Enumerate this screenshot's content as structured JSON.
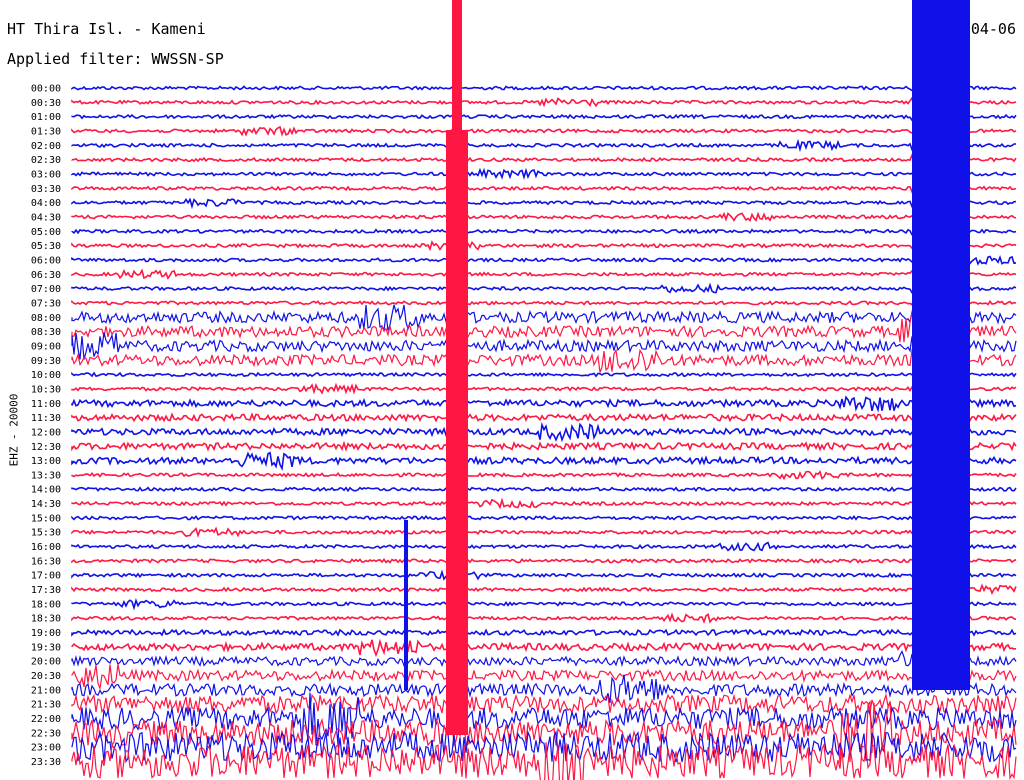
{
  "header": {
    "station": "HT Thira Isl. - Kameni",
    "filter_label": "Applied filter: WWSSN-SP",
    "date_fragment": "-04-06"
  },
  "axis": {
    "channel_label": "EHZ - 20000"
  },
  "colors": {
    "trace_a": "#1010e8",
    "trace_b": "#ff1744",
    "background": "#ffffff"
  },
  "chart_data": {
    "type": "seismogram",
    "row_labels": [
      "00:00",
      "00:30",
      "01:00",
      "01:30",
      "02:00",
      "02:30",
      "03:00",
      "03:30",
      "04:00",
      "04:30",
      "05:00",
      "05:30",
      "06:00",
      "06:30",
      "07:00",
      "07:30",
      "08:00",
      "08:30",
      "09:00",
      "09:30",
      "10:00",
      "10:30",
      "11:00",
      "11:30",
      "12:00",
      "12:30",
      "13:00",
      "13:30",
      "14:00",
      "14:30",
      "15:00",
      "15:30",
      "16:00",
      "16:30",
      "17:00",
      "17:30",
      "18:00",
      "18:30",
      "19:00",
      "19:30",
      "20:00",
      "20:30",
      "21:00",
      "21:30",
      "22:00",
      "22:30",
      "23:00",
      "23:30"
    ],
    "alternating_colors": [
      "blue",
      "red"
    ]
  }
}
